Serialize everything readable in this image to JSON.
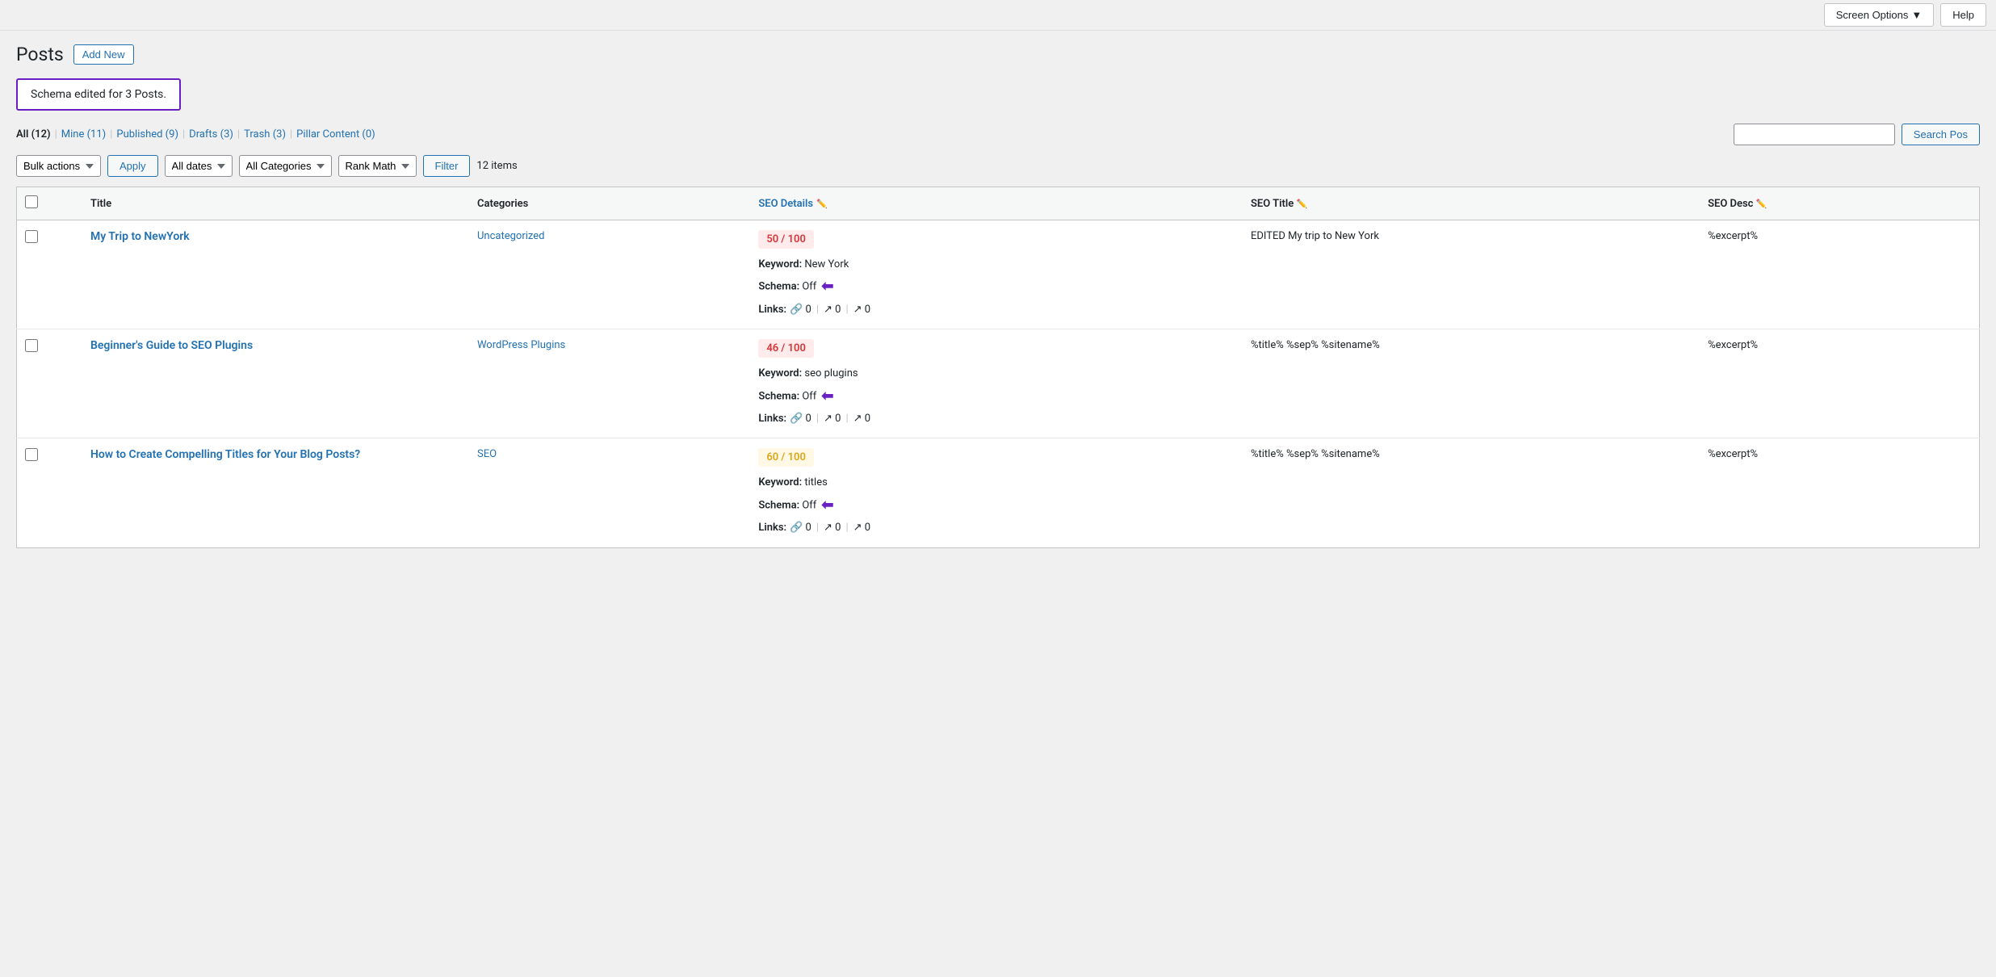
{
  "topbar": {
    "screen_options_label": "Screen Options",
    "screen_options_arrow": "▼",
    "help_label": "Help"
  },
  "header": {
    "title": "Posts",
    "add_new_label": "Add New"
  },
  "notice": {
    "message": "Schema edited for 3 Posts."
  },
  "filters": {
    "status_links": [
      {
        "label": "All",
        "count": "12",
        "current": true
      },
      {
        "label": "Mine",
        "count": "11",
        "current": false
      },
      {
        "label": "Published",
        "count": "9",
        "current": false
      },
      {
        "label": "Drafts",
        "count": "3",
        "current": false
      },
      {
        "label": "Trash",
        "count": "3",
        "current": false
      },
      {
        "label": "Pillar Content",
        "count": "0",
        "current": false
      }
    ],
    "bulk_actions_label": "Bulk actions",
    "apply_label": "Apply",
    "all_dates_label": "All dates",
    "all_categories_label": "All Categories",
    "rank_math_label": "Rank Math",
    "filter_label": "Filter",
    "items_count": "12 items",
    "search_placeholder": "",
    "search_button_label": "Search Pos"
  },
  "table": {
    "columns": [
      {
        "id": "title",
        "label": "Title",
        "clickable": false
      },
      {
        "id": "categories",
        "label": "Categories",
        "clickable": false
      },
      {
        "id": "seo_details",
        "label": "SEO Details",
        "clickable": true,
        "has_edit": true
      },
      {
        "id": "seo_title",
        "label": "SEO Title",
        "clickable": false,
        "has_edit": true
      },
      {
        "id": "seo_desc",
        "label": "SEO Desc",
        "clickable": false,
        "has_edit": true
      }
    ],
    "rows": [
      {
        "title": "My Trip to NewYork",
        "category": "Uncategorized",
        "seo_score": "50 / 100",
        "seo_score_class": "bad",
        "keyword": "New York",
        "schema": "Off",
        "links_internal": "0",
        "links_external": "0",
        "links_other": "0",
        "seo_title": "EDITED My trip to New York",
        "seo_desc": "%excerpt%",
        "has_arrow": true
      },
      {
        "title": "Beginner's Guide to SEO Plugins",
        "category": "WordPress Plugins",
        "seo_score": "46 / 100",
        "seo_score_class": "bad",
        "keyword": "seo plugins",
        "schema": "Off",
        "links_internal": "0",
        "links_external": "0",
        "links_other": "0",
        "seo_title": "%title% %sep% %sitename%",
        "seo_desc": "%excerpt%",
        "has_arrow": true
      },
      {
        "title": "How to Create Compelling Titles for Your Blog Posts?",
        "category": "SEO",
        "seo_score": "60 / 100",
        "seo_score_class": "medium",
        "keyword": "titles",
        "schema": "Off",
        "links_internal": "0",
        "links_external": "0",
        "links_other": "0",
        "seo_title": "%title% %sep% %sitename%",
        "seo_desc": "%excerpt%",
        "has_arrow": true
      }
    ]
  }
}
